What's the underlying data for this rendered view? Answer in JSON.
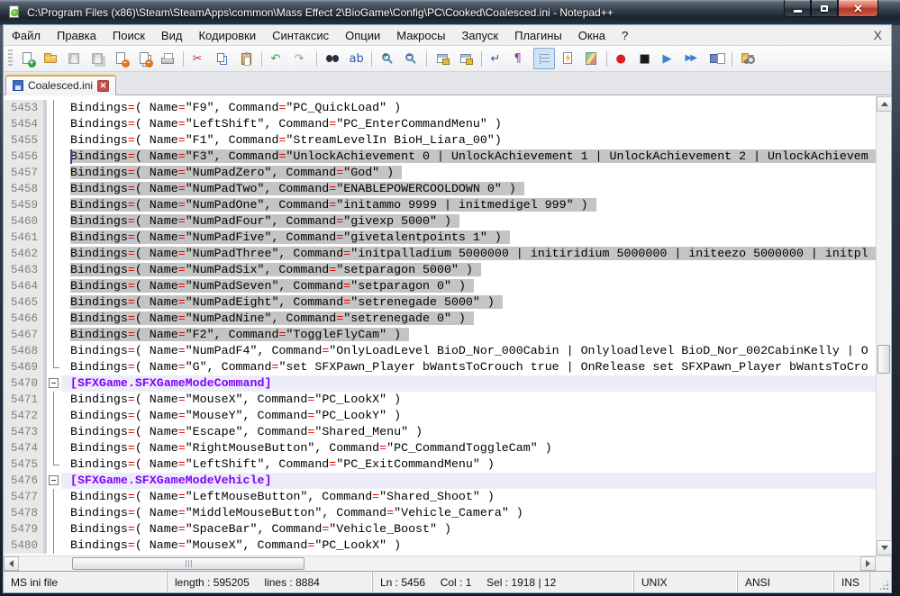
{
  "window": {
    "title": "C:\\Program Files (x86)\\Steam\\SteamApps\\common\\Mass Effect 2\\BioGame\\Config\\PC\\Cooked\\Coalesced.ini - Notepad++",
    "controls": {
      "minimize": "minimize",
      "maximize": "maximize",
      "close": "close"
    }
  },
  "menu": {
    "items": [
      "Файл",
      "Правка",
      "Поиск",
      "Вид",
      "Кодировки",
      "Синтаксис",
      "Опции",
      "Макросы",
      "Запуск",
      "Плагины",
      "Окна",
      "?"
    ],
    "doc_close_label": "X"
  },
  "toolbar": {
    "buttons": [
      {
        "name": "new-file",
        "kind": "page-new"
      },
      {
        "name": "open-file",
        "kind": "folder"
      },
      {
        "name": "save-file",
        "kind": "disk",
        "disabled": true
      },
      {
        "name": "save-all",
        "kind": "disk-all",
        "disabled": true
      },
      {
        "name": "close-file",
        "kind": "page-close"
      },
      {
        "name": "close-all",
        "kind": "pages-close"
      },
      {
        "name": "print",
        "kind": "printer"
      },
      {
        "sep": true
      },
      {
        "name": "cut",
        "kind": "glyph",
        "glyph": "✂",
        "color": "#c0392b"
      },
      {
        "name": "copy",
        "kind": "copy"
      },
      {
        "name": "paste",
        "kind": "paste"
      },
      {
        "sep": true
      },
      {
        "name": "undo",
        "kind": "glyph",
        "glyph": "↶",
        "color": "#2f9e44"
      },
      {
        "name": "redo",
        "kind": "glyph",
        "glyph": "↷",
        "color": "#9aa0a6"
      },
      {
        "sep": true
      },
      {
        "name": "find",
        "kind": "binoculars"
      },
      {
        "name": "replace",
        "kind": "glyph",
        "glyph": "ab",
        "color": "#2a5fae"
      },
      {
        "sep": true
      },
      {
        "name": "zoom-in",
        "kind": "zoom-in"
      },
      {
        "name": "zoom-out",
        "kind": "zoom-out"
      },
      {
        "sep": true
      },
      {
        "name": "sync-vertical-scroll",
        "kind": "lock-window"
      },
      {
        "name": "sync-horizontal-scroll",
        "kind": "lock-window"
      },
      {
        "sep": true
      },
      {
        "name": "word-wrap",
        "kind": "glyph",
        "glyph": "↵",
        "color": "#355f9e"
      },
      {
        "name": "show-all-characters",
        "kind": "glyph",
        "glyph": "¶",
        "color": "#8a3a9e"
      },
      {
        "name": "show-indent-guide",
        "kind": "indent",
        "pressed": true
      },
      {
        "name": "user-defined-dialog",
        "kind": "udl"
      },
      {
        "name": "document-map",
        "kind": "docmap"
      },
      {
        "sep": true
      },
      {
        "name": "start-recording",
        "kind": "glyph",
        "glyph": "●",
        "color": "#d81f1f"
      },
      {
        "name": "stop-recording",
        "kind": "glyph",
        "glyph": "■",
        "color": "#1a1a1a"
      },
      {
        "name": "playback-macro",
        "kind": "glyph",
        "glyph": "▶",
        "color": "#3f7fd0"
      },
      {
        "name": "run-macro-multiple",
        "kind": "glyph2",
        "glyph": "▶▶",
        "color": "#3f7fd0"
      },
      {
        "name": "save-macro",
        "kind": "save-macro"
      },
      {
        "sep": true
      },
      {
        "name": "plugins-folder",
        "kind": "folder-link"
      }
    ]
  },
  "tabs": [
    {
      "label": "Coalesced.ini",
      "active": true,
      "close_label": "x"
    }
  ],
  "editor": {
    "lines": [
      {
        "num": 5453,
        "kind": "binding",
        "fold": "line",
        "text": "Bindings=( Name=\"F9\", Command=\"PC_QuickLoad\" )"
      },
      {
        "num": 5454,
        "kind": "binding",
        "fold": "line",
        "text": "Bindings=( Name=\"LeftShift\", Command=\"PC_EnterCommandMenu\" )"
      },
      {
        "num": 5455,
        "kind": "binding",
        "fold": "line",
        "text": "Bindings=( Name=\"F1\", Command=\"StreamLevelIn BioH_Liara_00\")"
      },
      {
        "num": 5456,
        "kind": "binding",
        "fold": "line",
        "selected": true,
        "caret": true,
        "text": "Bindings=( Name=\"F3\", Command=\"UnlockAchievement 0 | UnlockAchievement 1 | UnlockAchievement 2 | UnlockAchievem"
      },
      {
        "num": 5457,
        "kind": "binding",
        "fold": "line",
        "selected": true,
        "text": "Bindings=( Name=\"NumPadZero\", Command=\"God\" )"
      },
      {
        "num": 5458,
        "kind": "binding",
        "fold": "line",
        "selected": true,
        "text": "Bindings=( Name=\"NumPadTwo\", Command=\"ENABLEPOWERCOOLDOWN 0\" )"
      },
      {
        "num": 5459,
        "kind": "binding",
        "fold": "line",
        "selected": true,
        "text": "Bindings=( Name=\"NumPadOne\", Command=\"initammo 9999 | initmedigel 999\" )"
      },
      {
        "num": 5460,
        "kind": "binding",
        "fold": "line",
        "selected": true,
        "text": "Bindings=( Name=\"NumPadFour\", Command=\"givexp 5000\" )"
      },
      {
        "num": 5461,
        "kind": "binding",
        "fold": "line",
        "selected": true,
        "text": "Bindings=( Name=\"NumPadFive\", Command=\"givetalentpoints 1\" )"
      },
      {
        "num": 5462,
        "kind": "binding",
        "fold": "line",
        "selected": true,
        "text": "Bindings=( Name=\"NumPadThree\", Command=\"initpalladium 5000000 | initiridium 5000000 | initeezo 5000000 | initpl"
      },
      {
        "num": 5463,
        "kind": "binding",
        "fold": "line",
        "selected": true,
        "text": "Bindings=( Name=\"NumPadSix\", Command=\"setparagon 5000\" )"
      },
      {
        "num": 5464,
        "kind": "binding",
        "fold": "line",
        "selected": true,
        "text": "Bindings=( Name=\"NumPadSeven\", Command=\"setparagon 0\" )"
      },
      {
        "num": 5465,
        "kind": "binding",
        "fold": "line",
        "selected": true,
        "text": "Bindings=( Name=\"NumPadEight\", Command=\"setrenegade 5000\" )"
      },
      {
        "num": 5466,
        "kind": "binding",
        "fold": "line",
        "selected": true,
        "text": "Bindings=( Name=\"NumPadNine\", Command=\"setrenegade 0\" )"
      },
      {
        "num": 5467,
        "kind": "binding",
        "fold": "line",
        "selected": true,
        "text": "Bindings=( Name=\"F2\", Command=\"ToggleFlyCam\" )"
      },
      {
        "num": 5468,
        "kind": "binding",
        "fold": "line",
        "text": "Bindings=( Name=\"NumPadF4\", Command=\"OnlyLoadLevel BioD_Nor_000Cabin | Onlyloadlevel BioD_Nor_002CabinKelly | O"
      },
      {
        "num": 5469,
        "kind": "binding",
        "fold": "end",
        "text": "Bindings=( Name=\"G\", Command=\"set SFXPawn_Player bWantsToCrouch true | OnRelease set SFXPawn_Player bWantsToCro"
      },
      {
        "num": 5470,
        "kind": "section",
        "fold": "minus",
        "text": "[SFXGame.SFXGameModeCommand]"
      },
      {
        "num": 5471,
        "kind": "binding",
        "fold": "line",
        "text": "Bindings=( Name=\"MouseX\", Command=\"PC_LookX\" )"
      },
      {
        "num": 5472,
        "kind": "binding",
        "fold": "line",
        "text": "Bindings=( Name=\"MouseY\", Command=\"PC_LookY\" )"
      },
      {
        "num": 5473,
        "kind": "binding",
        "fold": "line",
        "text": "Bindings=( Name=\"Escape\", Command=\"Shared_Menu\" )"
      },
      {
        "num": 5474,
        "kind": "binding",
        "fold": "line",
        "text": "Bindings=( Name=\"RightMouseButton\", Command=\"PC_CommandToggleCam\" )"
      },
      {
        "num": 5475,
        "kind": "binding",
        "fold": "end",
        "text": "Bindings=( Name=\"LeftShift\", Command=\"PC_ExitCommandMenu\" )"
      },
      {
        "num": 5476,
        "kind": "section",
        "fold": "minus",
        "text": "[SFXGame.SFXGameModeVehicle]"
      },
      {
        "num": 5477,
        "kind": "binding",
        "fold": "line",
        "text": "Bindings=( Name=\"LeftMouseButton\", Command=\"Shared_Shoot\" )"
      },
      {
        "num": 5478,
        "kind": "binding",
        "fold": "line",
        "text": "Bindings=( Name=\"MiddleMouseButton\", Command=\"Vehicle_Camera\" )"
      },
      {
        "num": 5479,
        "kind": "binding",
        "fold": "line",
        "text": "Bindings=( Name=\"SpaceBar\", Command=\"Vehicle_Boost\" )"
      },
      {
        "num": 5480,
        "kind": "binding",
        "fold": "line",
        "text": "Bindings=( Name=\"MouseX\", Command=\"PC_LookX\" )"
      }
    ],
    "colors": {
      "selection": "#c4c4c4",
      "operator": "#e00000",
      "section": "#8000ff",
      "section_bg": "#ededfa",
      "line_number": "#808080"
    }
  },
  "statusbar": {
    "doc_type": "MS ini file",
    "metrics": "length : 595205     lines : 8884",
    "position": "Ln : 5456     Col : 1     Sel : 1918 | 12",
    "eol": "UNIX",
    "encoding": "ANSI",
    "insert_mode": "INS"
  }
}
